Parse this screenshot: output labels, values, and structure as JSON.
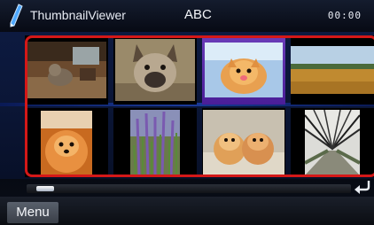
{
  "header": {
    "app_title": "ThumbnailViewer",
    "center_title": "ABC",
    "clock": "00:00"
  },
  "grid": {
    "columns": 4,
    "thumbnails": [
      {
        "subject": "small dog in living room",
        "selected": false
      },
      {
        "subject": "bulldog face",
        "selected": false
      },
      {
        "subject": "pomeranian",
        "selected": true
      },
      {
        "subject": "open field landscape",
        "selected": false
      },
      {
        "subject": "pomeranian portrait",
        "selected": false
      },
      {
        "subject": "lavender field",
        "selected": false
      },
      {
        "subject": "two puppies",
        "selected": false
      },
      {
        "subject": "bridge walkway",
        "selected": false
      }
    ]
  },
  "scroll": {
    "position": 0.02
  },
  "bottom_bar": {
    "menu_label": "Menu"
  },
  "colors": {
    "selection_frame": "#d41818",
    "grid_background": "#0b1636",
    "selected_highlight": "#6a3cb8"
  },
  "icons": [
    "pencil-icon",
    "back-arrow-icon"
  ]
}
